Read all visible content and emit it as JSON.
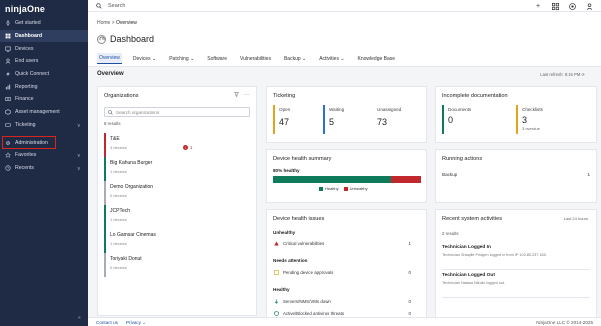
{
  "brand": {
    "logo_text": "ninjaOne"
  },
  "sidebar": {
    "items": [
      {
        "label": "Get started",
        "icon": "rocket-icon"
      },
      {
        "label": "Dashboard",
        "icon": "dashboard-icon",
        "active": true
      },
      {
        "label": "Devices",
        "icon": "monitor-icon"
      },
      {
        "label": "End users",
        "icon": "users-icon"
      },
      {
        "label": "Quick Connect",
        "icon": "quick-connect-icon"
      },
      {
        "label": "Reporting",
        "icon": "chart-icon"
      },
      {
        "label": "Finance",
        "icon": "finance-icon"
      },
      {
        "label": "Asset management",
        "icon": "asset-icon"
      },
      {
        "label": "Ticketing",
        "icon": "ticket-icon",
        "chevron": "v"
      },
      {
        "label": "Administration",
        "icon": "gear-icon",
        "highlighted": true
      },
      {
        "label": "Favorites",
        "icon": "star-icon",
        "chevron": "v"
      },
      {
        "label": "Recents",
        "icon": "clock-icon",
        "chevron": "v"
      }
    ],
    "collapse_glyph": "«"
  },
  "topbar": {
    "search_label": "Search",
    "icons": [
      "plus-icon",
      "grid-icon",
      "help-icon",
      "user-icon"
    ]
  },
  "header": {
    "breadcrumb_home": "Home",
    "breadcrumb_sep": ">",
    "breadcrumb_current": "Overview",
    "title": "Dashboard",
    "tabs": [
      {
        "label": "Overview",
        "active": true
      },
      {
        "label": "Devices ⌄"
      },
      {
        "label": "Patching ⌄"
      },
      {
        "label": "Software"
      },
      {
        "label": "Vulnerabilities"
      },
      {
        "label": "Backup ⌄"
      },
      {
        "label": "Activities ⌄"
      },
      {
        "label": "Knowledge Base"
      }
    ]
  },
  "overview": {
    "title": "Overview",
    "last_refresh": "Last refresh: 8:15 PM ⟳"
  },
  "organizations": {
    "title": "Organizations",
    "search_placeholder": "Search organizations",
    "count": "8 results",
    "items": [
      {
        "name": "T&E",
        "devices": "3 devices",
        "status": "warn",
        "alert_count": "1"
      },
      {
        "name": "Big Kahuna Burger",
        "devices": "1 devices",
        "status": "ok"
      },
      {
        "name": "Demo Organization",
        "devices": "0 devices",
        "status": "none"
      },
      {
        "name": "JCPTech",
        "devices": "1 devices",
        "status": "ok"
      },
      {
        "name": "Lo Gamsar Cinemas",
        "devices": "1 devices",
        "status": "ok"
      },
      {
        "name": "Toriyaki Donut",
        "devices": "0 devices",
        "status": "none"
      }
    ]
  },
  "ticketing": {
    "title": "Ticketing",
    "stats": [
      {
        "label": "Open",
        "value": "47",
        "color": "#e3a41c"
      },
      {
        "label": "Waiting",
        "value": "5",
        "color": "#2d6fd6"
      },
      {
        "label": "Unassigned",
        "value": "73",
        "color": "#ffffff"
      }
    ]
  },
  "documentation": {
    "title": "Incomplete documentation",
    "stats": [
      {
        "label": "Documents",
        "value": "0",
        "sub": "",
        "color": "#0f7b5b"
      },
      {
        "label": "Checklists",
        "value": "3",
        "sub": "3 overdue",
        "color": "#e3a41c"
      }
    ]
  },
  "health_summary": {
    "title": "Device health summary",
    "percent_label": "80% healthy",
    "healthy_fraction": 0.8,
    "legend_healthy": "Healthy",
    "legend_unhealthy": "Unhealthy",
    "healthy_color": "#0f7b5b",
    "unhealthy_color": "#c0282e"
  },
  "running_actions": {
    "title": "Running actions",
    "rows": [
      {
        "label": "Backup",
        "value": "1"
      }
    ]
  },
  "health_issues": {
    "title": "Device health issues",
    "sections": [
      {
        "heading": "Unhealthy",
        "rows": [
          {
            "icon": "warning-icon",
            "label": "Critical vulnerabilities",
            "value": "1"
          }
        ]
      },
      {
        "heading": "Needs attention",
        "rows": [
          {
            "icon": "pending-icon",
            "label": "Pending device approvals",
            "value": "0"
          }
        ]
      },
      {
        "heading": "Healthy",
        "rows": [
          {
            "icon": "arrow-down-icon",
            "label": "Servers/NMS/VMs down",
            "value": "0"
          },
          {
            "icon": "shield-icon",
            "label": "Active/Blocked antivirus threats",
            "value": "0"
          }
        ]
      }
    ]
  },
  "activities": {
    "title": "Recent system activities",
    "range": "Last 24 hours",
    "count": "2 results",
    "items": [
      {
        "title": "Technician Logged In",
        "detail": "Technician Shaqille Pridgen logged in from IP 103.85.237.165."
      },
      {
        "title": "Technician Logged Out",
        "detail": "Technician Natasa Nikolic logged out."
      }
    ]
  },
  "footer": {
    "contact": "Contact us",
    "privacy": "Privacy ⌄",
    "copyright": "NinjaOne LLC © 2014-2025"
  }
}
